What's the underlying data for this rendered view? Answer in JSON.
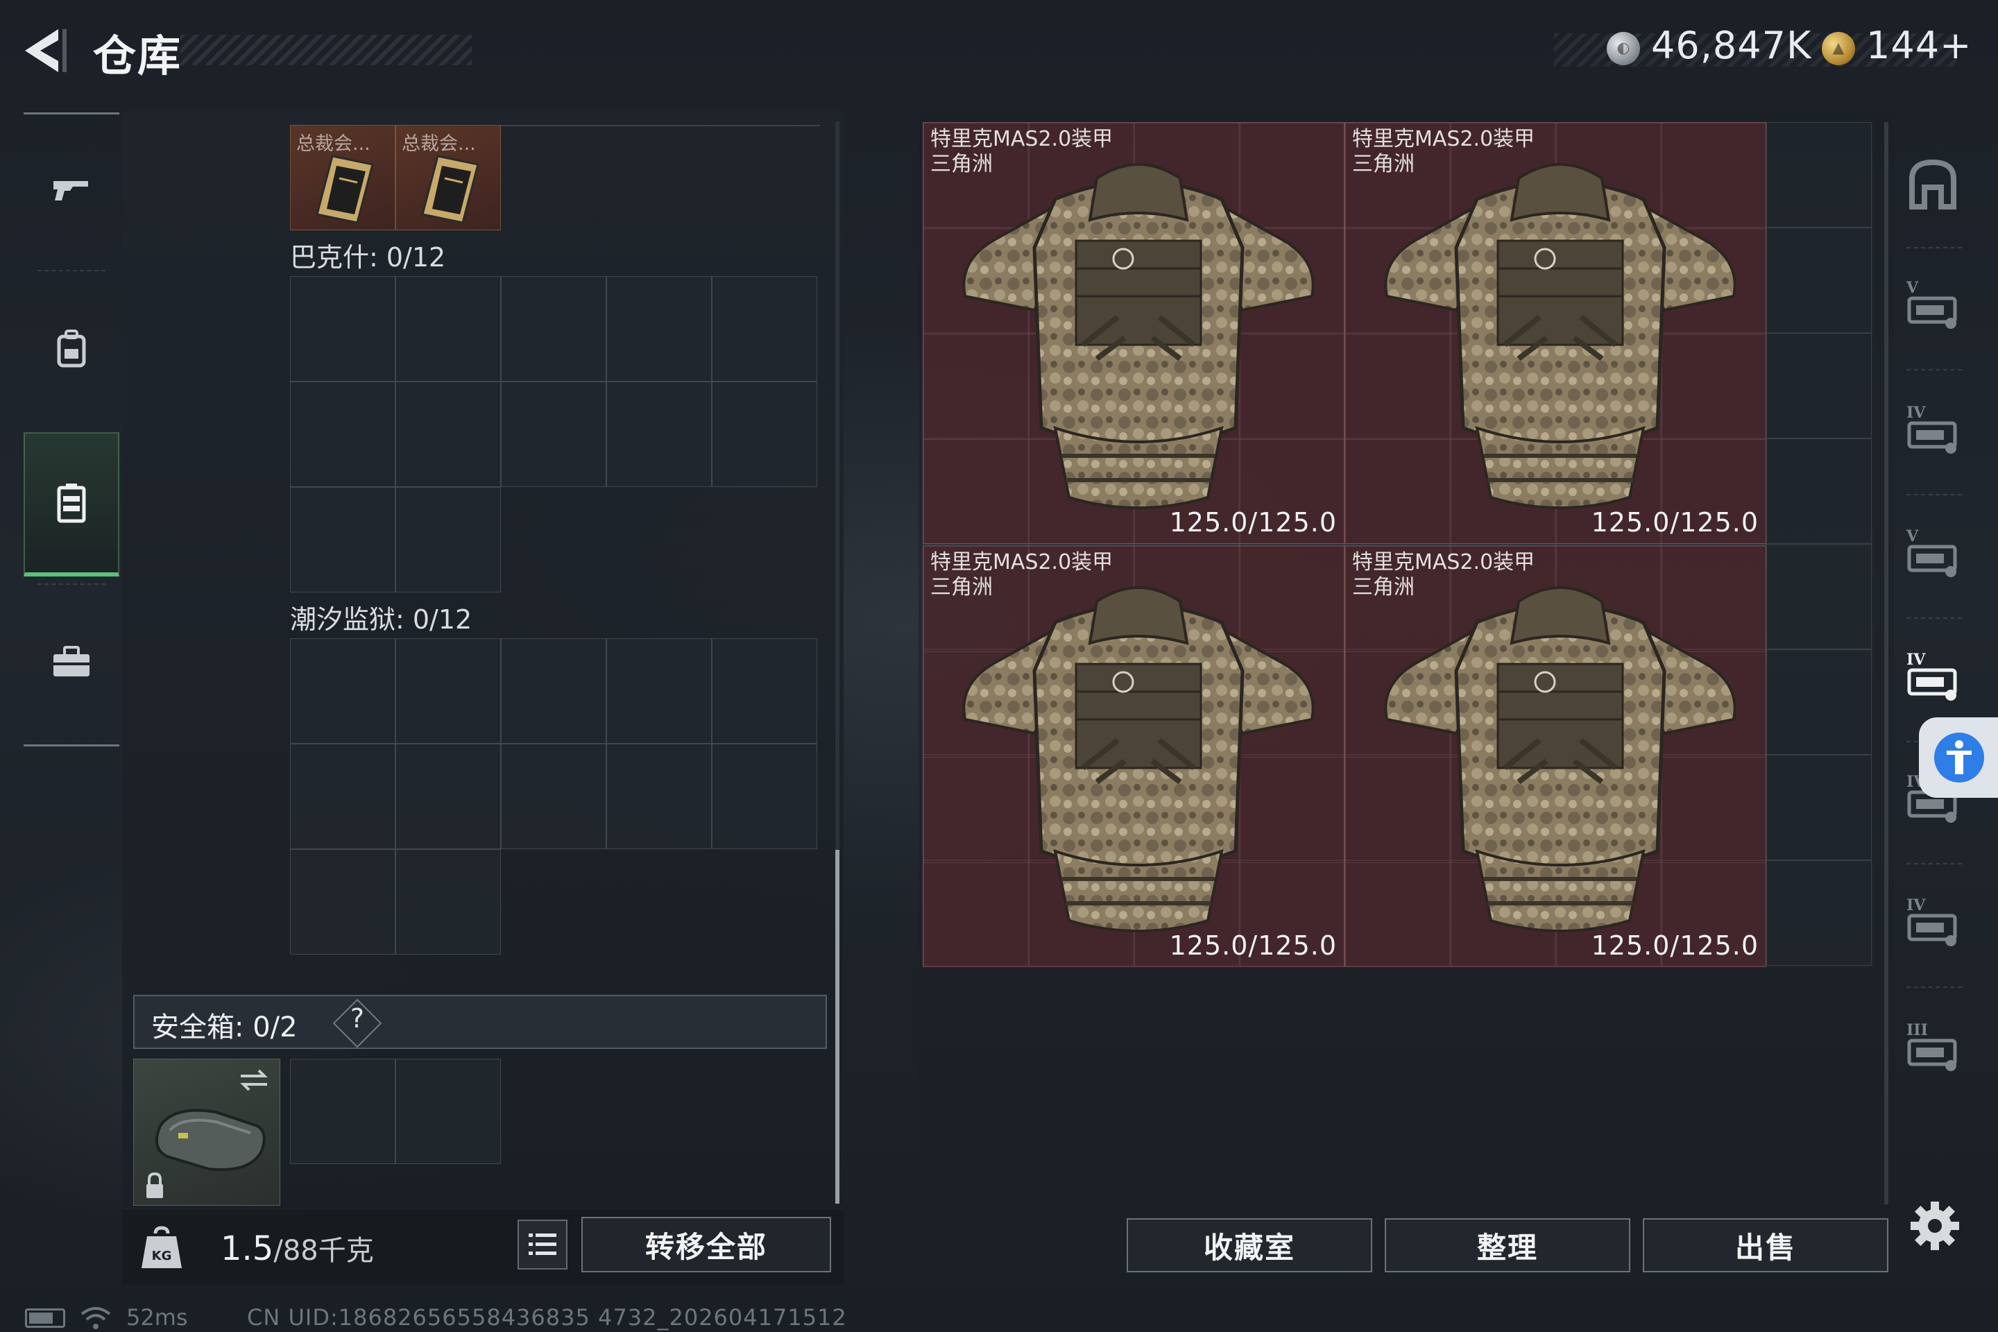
{
  "header": {
    "title": "仓库",
    "currency_primary": "46,847K",
    "currency_secondary": "144+"
  },
  "left_nav": {
    "items": [
      {
        "icon": "gun-icon",
        "active": false
      },
      {
        "icon": "backpack-icon",
        "active": false
      },
      {
        "icon": "chest-rig-icon",
        "active": true
      },
      {
        "icon": "toolbox-icon",
        "active": false
      }
    ]
  },
  "container": {
    "top_items": [
      {
        "name": "总裁会..."
      },
      {
        "name": "总裁会..."
      }
    ],
    "sections": [
      {
        "label": "巴克什: 0/12"
      },
      {
        "label": "潮汐监狱: 0/12"
      }
    ]
  },
  "safe_box": {
    "label": "安全箱:  0/2",
    "help": "?",
    "swap_icon": "swap-icon",
    "lock_icon": "lock-icon"
  },
  "weight": {
    "current": "1.5",
    "max": "/88千克"
  },
  "bottom_left": {
    "transfer_all": "转移全部"
  },
  "stash": {
    "items": [
      {
        "name": "特里克MAS2.0装甲",
        "map": "三角洲",
        "durability": "125.0/125.0"
      },
      {
        "name": "特里克MAS2.0装甲",
        "map": "三角洲",
        "durability": "125.0/125.0"
      },
      {
        "name": "特里克MAS2.0装甲",
        "map": "三角洲",
        "durability": "125.0/125.0"
      },
      {
        "name": "特里克MAS2.0装甲",
        "map": "三角洲",
        "durability": "125.0/125.0"
      }
    ]
  },
  "right_nav": {
    "items": [
      {
        "icon": "armor-category-icon"
      },
      {
        "icon": "armor-tier-v-icon"
      },
      {
        "icon": "armor-tier-iv-icon"
      },
      {
        "icon": "armor-tier-v-alt-icon"
      },
      {
        "icon": "armor-tier-iv-active-icon"
      },
      {
        "icon": "armor-tier-iv-icon"
      },
      {
        "icon": "armor-tier-iv-icon"
      },
      {
        "icon": "armor-tier-iii-icon"
      }
    ]
  },
  "actions": {
    "collection": "收藏室",
    "organize": "整理",
    "sell": "出售"
  },
  "status": {
    "ping": "52ms",
    "uid": "CN UID:18682656558436835 4732_202604171512"
  },
  "colors": {
    "armor_bg": "#60282c",
    "active_nav": "#5fbf7a",
    "accessibility": "#2f7ee8"
  }
}
